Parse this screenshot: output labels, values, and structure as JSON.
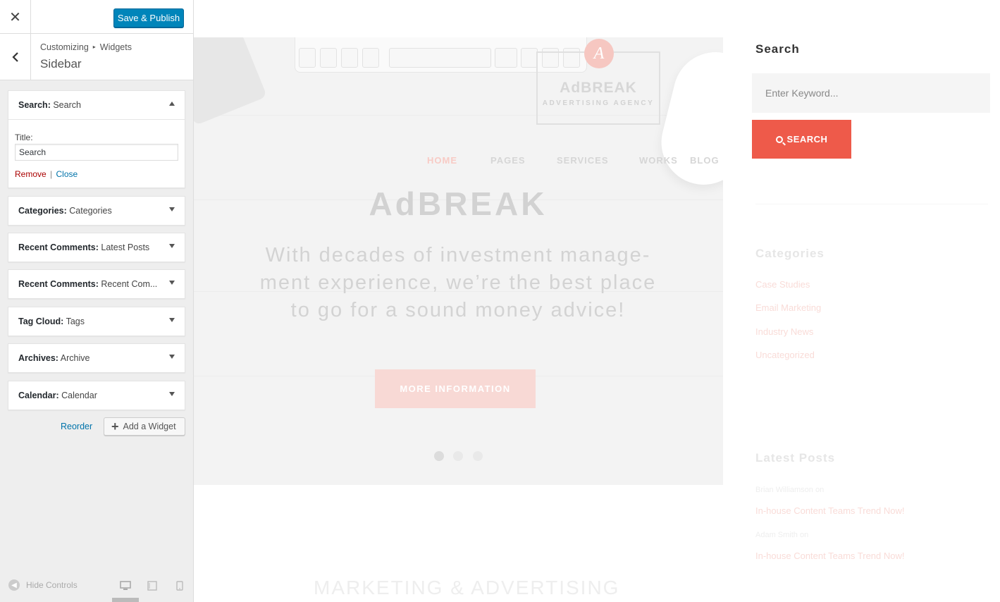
{
  "panel": {
    "close_label": "✕",
    "save_publish_label": "Save & Publish",
    "breadcrumb": {
      "parent": "Customizing",
      "separator": "▸",
      "current": "Widgets"
    },
    "section_title": "Sidebar"
  },
  "widgets": [
    {
      "name": "Search:",
      "instance": " Search",
      "expanded": true,
      "title_label": "Title:",
      "title_value": "Search",
      "remove_label": "Remove",
      "separator": "|",
      "close_label": "Close"
    },
    {
      "name": "Categories:",
      "instance": " Categories",
      "expanded": false
    },
    {
      "name": "Recent Comments:",
      "instance": " Latest Posts",
      "expanded": false
    },
    {
      "name": "Recent Comments:",
      "instance": " Recent Com...",
      "expanded": false
    },
    {
      "name": "Tag Cloud:",
      "instance": " Tags",
      "expanded": false
    },
    {
      "name": "Archives:",
      "instance": " Archive",
      "expanded": false
    },
    {
      "name": "Calendar:",
      "instance": " Calendar",
      "expanded": false
    }
  ],
  "actions": {
    "reorder_label": "Reorder",
    "add_widget_label": "Add a Widget"
  },
  "footer": {
    "hide_controls_label": "Hide Controls",
    "devices": [
      "desktop-icon",
      "tablet-icon",
      "mobile-icon"
    ],
    "active_device": "desktop"
  },
  "preview": {
    "logo": {
      "badge": "A",
      "name": "AdBREAK",
      "tagline": "ADVERTISING AGENCY"
    },
    "nav": [
      "HOME",
      "PAGES",
      "SERVICES",
      "WORKS",
      "BLOG"
    ],
    "active_nav": "HOME",
    "hero_title": "AdBREAK",
    "hero_text": "With decades of investment manage-ment experience, we’re the best place to go for a sound money advice!",
    "cta_label": "MORE INFORMATION",
    "slider_dots": 3,
    "section_heading": "MARKETING & ADVERTISING",
    "sidebar": {
      "search_title": "Search",
      "search_placeholder": "Enter Keyword...",
      "search_button": "SEARCH",
      "categories_title": "Categories",
      "categories": [
        "Case Studies",
        "Email Marketing",
        "Industry News",
        "Uncategorized"
      ],
      "latest_posts_title": "Latest Posts",
      "latest_posts": [
        {
          "author": "Brian Williamson",
          "on": "on",
          "title": "In-house Content Teams Trend Now!"
        },
        {
          "author": "Adam Smith",
          "on": "on",
          "title": "In-house Content Teams Trend Now!"
        }
      ]
    }
  },
  "colors": {
    "accent_blue": "#0085ba",
    "link_blue": "#0073aa",
    "remove_red": "#aa0000",
    "brand_red": "#ee5a4a"
  }
}
